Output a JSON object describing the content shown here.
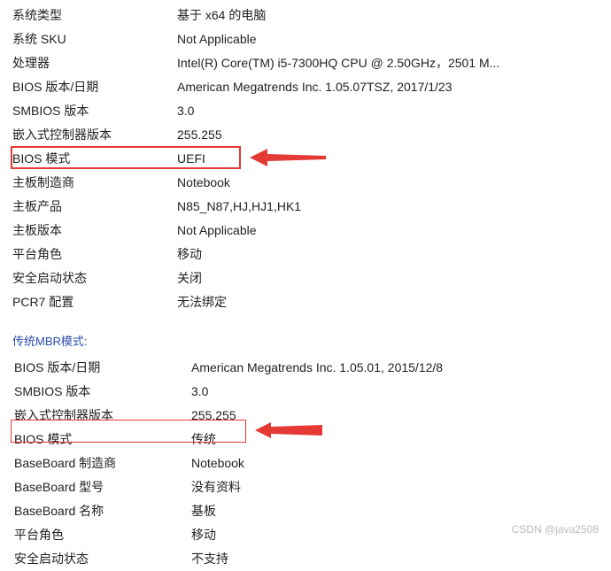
{
  "section1": {
    "rows": [
      {
        "label": "系统类型",
        "value": "基于 x64 的电脑"
      },
      {
        "label": "系统 SKU",
        "value": "Not Applicable"
      },
      {
        "label": "处理器",
        "value": "Intel(R) Core(TM) i5-7300HQ CPU @ 2.50GHz，2501 M..."
      },
      {
        "label": "BIOS 版本/日期",
        "value": "American Megatrends Inc. 1.05.07TSZ, 2017/1/23"
      },
      {
        "label": "SMBIOS 版本",
        "value": "3.0"
      },
      {
        "label": "嵌入式控制器版本",
        "value": "255.255"
      },
      {
        "label": "BIOS 模式",
        "value": "UEFI"
      },
      {
        "label": "主板制造商",
        "value": "Notebook"
      },
      {
        "label": "主板产品",
        "value": "N85_N87,HJ,HJ1,HK1"
      },
      {
        "label": "主板版本",
        "value": "Not Applicable"
      },
      {
        "label": "平台角色",
        "value": "移动"
      },
      {
        "label": "安全启动状态",
        "value": "关闭"
      },
      {
        "label": "PCR7 配置",
        "value": "无法绑定"
      }
    ]
  },
  "section2": {
    "title": "传统MBR模式:",
    "rows": [
      {
        "label": "BIOS 版本/日期",
        "value": "American Megatrends Inc. 1.05.01, 2015/12/8"
      },
      {
        "label": "SMBIOS 版本",
        "value": "3.0"
      },
      {
        "label": "嵌入式控制器版本",
        "value": "255.255"
      },
      {
        "label": "BIOS 模式",
        "value": "传统"
      },
      {
        "label": "BaseBoard 制造商",
        "value": "Notebook"
      },
      {
        "label": "BaseBoard 型号",
        "value": "没有资料"
      },
      {
        "label": "BaseBoard 名称",
        "value": "基板"
      },
      {
        "label": "平台角色",
        "value": "移动"
      },
      {
        "label": "安全启动状态",
        "value": "不支持"
      }
    ]
  },
  "watermark": "CSDN @java2508"
}
